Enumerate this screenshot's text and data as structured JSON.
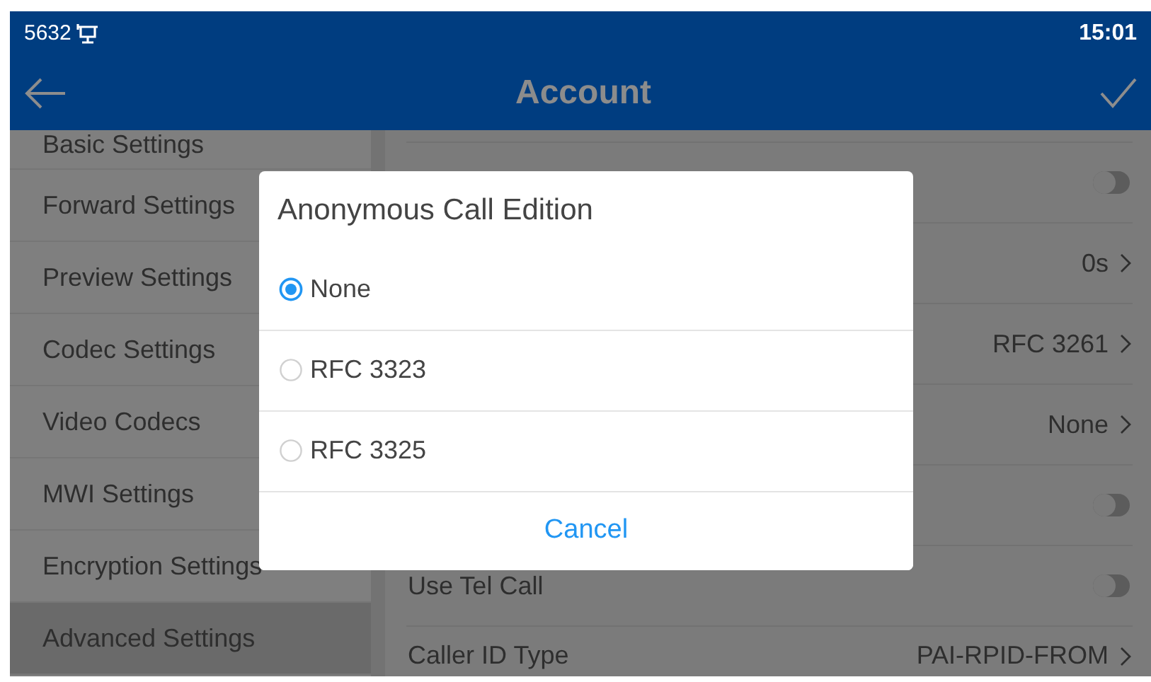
{
  "status_bar": {
    "extension": "5632",
    "time": "15:01"
  },
  "header": {
    "title": "Account"
  },
  "sidebar": {
    "items": [
      {
        "label": "Basic Settings",
        "selected": false
      },
      {
        "label": "Forward Settings",
        "selected": false
      },
      {
        "label": "Preview Settings",
        "selected": false
      },
      {
        "label": "Codec Settings",
        "selected": false
      },
      {
        "label": "Video Codecs",
        "selected": false
      },
      {
        "label": "MWI Settings",
        "selected": false
      },
      {
        "label": "Encryption Settings",
        "selected": false
      },
      {
        "label": "Advanced Settings",
        "selected": true
      }
    ]
  },
  "settings": [
    {
      "kind": "toggle",
      "on": false
    },
    {
      "kind": "value",
      "value": "0s"
    },
    {
      "kind": "value",
      "value": "RFC 3261"
    },
    {
      "kind": "value",
      "value": "None"
    },
    {
      "kind": "toggle",
      "on": false
    },
    {
      "kind": "toggle",
      "label": "Use Tel Call",
      "on": false
    },
    {
      "kind": "value",
      "label": "Caller ID Type",
      "value": "PAI-RPID-FROM"
    }
  ],
  "dialog": {
    "title": "Anonymous Call Edition",
    "options": [
      {
        "label": "None",
        "selected": true
      },
      {
        "label": "RFC 3323",
        "selected": false
      },
      {
        "label": "RFC 3325",
        "selected": false
      }
    ],
    "cancel": "Cancel"
  }
}
